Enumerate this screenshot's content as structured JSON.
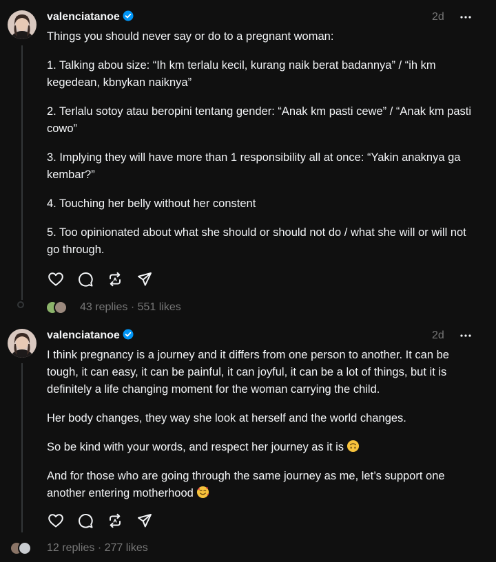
{
  "posts": [
    {
      "username": "valenciatanoe",
      "time": "2d",
      "paragraphs": [
        "Things you should never say or do to a pregnant woman:",
        "1. Talking abou size: “Ih km terlalu kecil, kurang naik berat badannya” / “ih km kegedean, kbnykan naiknya”",
        "2. Terlalu sotoy atau beropini tentang gender: “Anak km pasti cewe” / “Anak km pasti cowo”",
        "3. Implying they will have more than 1 responsibility all at once: “Yakin anaknya ga kembar?”",
        "4. Touching her belly without her constent",
        "5. Too opinionated about what she should or should not do / what she will or will not go through."
      ],
      "replies": "43 replies",
      "likes": "551 likes",
      "separator": "·"
    },
    {
      "username": "valenciatanoe",
      "time": "2d",
      "paragraphs": [
        "I think pregnancy is a journey and it differs from one person to another. It can be tough, it can easy, it can be painful, it can joyful, it can be a lot of things, but it is definitely a life changing moment for the woman carrying the child.",
        "Her body changes, they way she look at herself and the world changes.",
        "So be kind with your words, and respect her journey as it is",
        "And for those who are going through the same journey as me, let’s support one another entering motherhood"
      ],
      "replies": "12 replies",
      "likes": "277 likes",
      "separator": "·"
    }
  ],
  "icons": {
    "like": "heart-icon",
    "comment": "comment-icon",
    "repost": "repost-icon",
    "share": "share-icon",
    "more": "more-icon",
    "verified": "verified-badge-icon",
    "emoji_upside_down": "upside-down-face-emoji",
    "emoji_hearts": "smiling-face-with-hearts-emoji"
  },
  "colors": {
    "background": "#101010",
    "text": "#f3f5f7",
    "muted": "#777777",
    "verified": "#0095f6",
    "thread_line": "#333638"
  }
}
